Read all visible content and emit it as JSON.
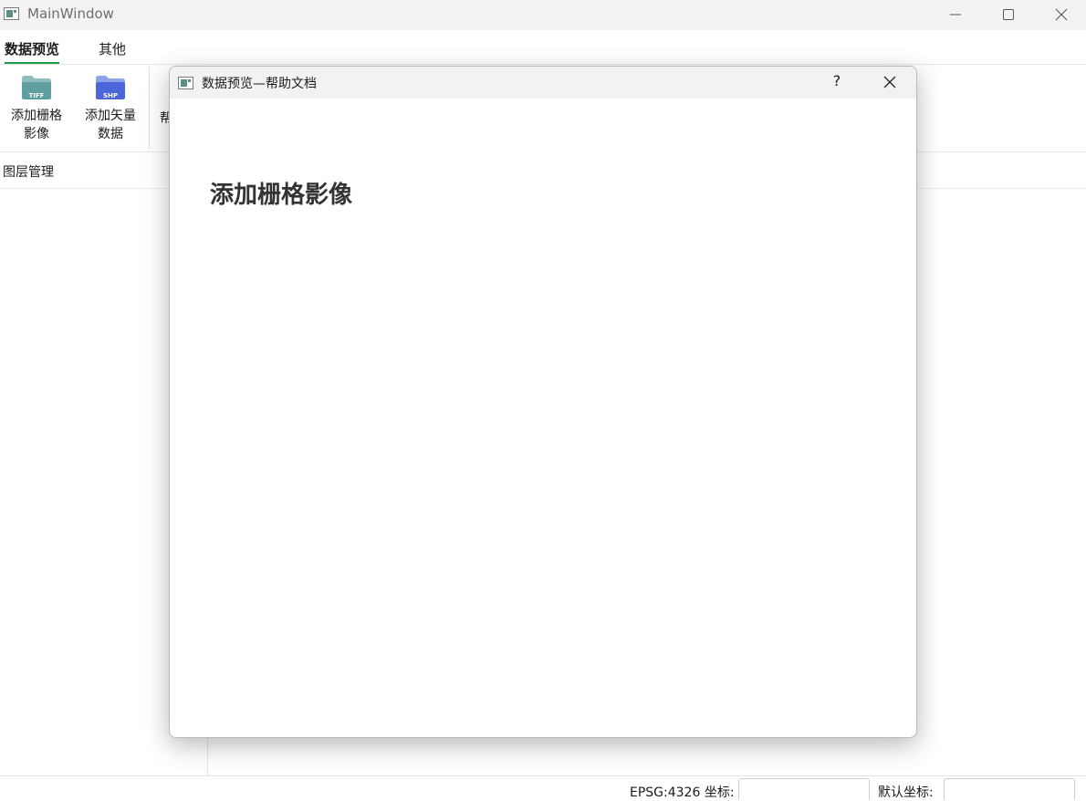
{
  "window": {
    "title": "MainWindow",
    "icon": "app-window-icon",
    "controls": [
      "minimize-icon",
      "maximize-icon",
      "close-icon"
    ]
  },
  "ribbon": {
    "tabs": [
      {
        "label": "数据预览",
        "active": true
      },
      {
        "label": "其他",
        "active": false
      }
    ],
    "tools": [
      {
        "line1": "添加栅格",
        "line2": "影像",
        "icon": "tiff-folder-icon",
        "badge": "TIFF",
        "color": "#5f9ea0"
      },
      {
        "line1": "添加矢量",
        "line2": "数据",
        "icon": "shp-folder-icon",
        "badge": "SHP",
        "color": "#4a66d8"
      }
    ],
    "partial_label": "帮"
  },
  "dock": {
    "title": "图层管理"
  },
  "statusbar": {
    "epsg_label": "EPSG:4326 坐标:",
    "default_label": "默认坐标:",
    "epsg_value": "",
    "default_value": ""
  },
  "dialog": {
    "title": "数据预览—帮助文档",
    "help_label": "?",
    "heading": "添加栅格影像"
  },
  "colors": {
    "accent": "#1d9b4b",
    "titlebar": "#f3f3f3",
    "dialog_titlebar": "#f1f3f3"
  }
}
